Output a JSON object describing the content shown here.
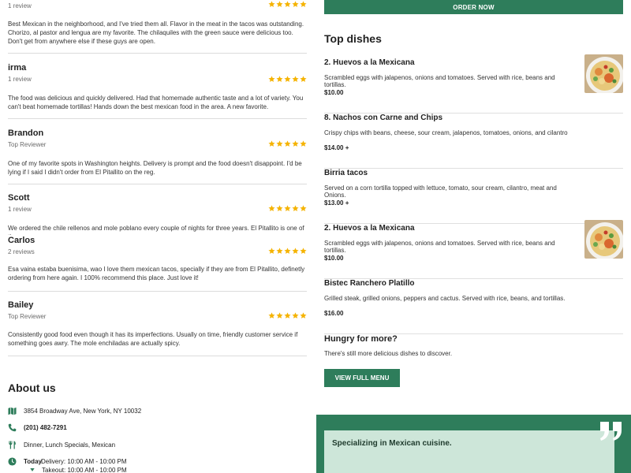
{
  "reviews": [
    {
      "name": "",
      "meta": "1 review",
      "text": "Best Mexican in the neighborhood, and I've tried them all. Flavor in the meat in the tacos was outstanding. Chorizo, al pastor and lengua are my favorite. The chilaquiles with the green sauce were delicious too. Don't get from anywhere else if these guys are open.",
      "rating": 5
    },
    {
      "name": "irma",
      "meta": "1 review",
      "text": "The food was delicious and quickly delivered. Had that homemade authentic taste and a lot of variety. You can't beat homemade tortillas! Hands down the best mexican food in the area. A new favorite.",
      "rating": 5
    },
    {
      "name": "Brandon",
      "meta": "Top Reviewer",
      "text": "One of my favorite spots in Washington heights. Delivery is prompt and the food doesn't disappoint. I'd be lying if I said I didn't order from El Pitallito on the reg.",
      "rating": 5
    },
    {
      "name": "Scott",
      "meta": "1 review",
      "text": "We ordered the chile rellenos and mole poblano every couple of nights for three years. El Pitallito is one of the",
      "rating": 5
    },
    {
      "name": "Carlos",
      "meta": "2 reviews",
      "text": "Esa vaina estaba buenisima, wao I love them mexican tacos, specially if they are from El Pitallito, definetly ordering from here again. I 100% recommend this place. Just love it!",
      "rating": 5
    },
    {
      "name": "Bailey",
      "meta": "Top Reviewer",
      "text": "Consistently good food even though it has its imperfections. Usually on time, friendly customer service if something goes awry. The mole enchiladas are actually spicy.",
      "rating": 5
    }
  ],
  "about": {
    "title": "About us",
    "address": "3854 Broadway Ave, New York, NY 10032",
    "phone": "(201) 482-7291",
    "services": "Dinner, Lunch Specials, Mexican",
    "hours_today_label": "Today",
    "hours_delivery": "Delivery: 10:00 AM - 10:00 PM",
    "hours_takeout": "Takeout: 10:00 AM - 10:00 PM"
  },
  "order_button": "ORDER NOW",
  "top_dishes": {
    "title": "Top dishes",
    "items": [
      {
        "name": "2. Huevos a la Mexicana",
        "desc": "Scrambled eggs with jalapenos, onions and tomatoes. Served with rice, beans and tortillas.",
        "price": "$10.00",
        "has_image": true
      },
      {
        "name": "8. Nachos con Carne and Chips",
        "desc": "Crispy chips with beans, cheese, sour cream, jalapenos, tomatoes, onions, and cilantro",
        "price": "$14.00 +",
        "has_image": false
      },
      {
        "name": "Birria tacos",
        "desc": "Served on a corn tortilla topped with lettuce, tomato, sour cream, cilantro, meat and Onions.",
        "price": "$13.00 +",
        "has_image": false
      },
      {
        "name": "2. Huevos a la Mexicana",
        "desc": "Scrambled eggs with jalapenos, onions and tomatoes. Served with rice, beans and tortillas.",
        "price": "$10.00",
        "has_image": true
      },
      {
        "name": "Bistec Ranchero Platillo",
        "desc": "Grilled steak, grilled onions, peppers and cactus. Served with rice, beans, and tortillas.",
        "price": "$16.00",
        "has_image": false
      }
    ]
  },
  "hungry": {
    "title": "Hungry for more?",
    "text": "There's still more delicious dishes to discover.",
    "button": "VIEW FULL MENU"
  },
  "specializing": {
    "text": "Specializing in Mexican cuisine."
  },
  "colors": {
    "brand_green": "#2e7d5b",
    "star": "#f5b301",
    "quote_card": "#cde6d9"
  },
  "icons": {
    "star": "star-icon",
    "address": "map-icon",
    "phone": "phone-icon",
    "services": "utensils-icon",
    "hours": "clock-icon",
    "quote": "quote-icon"
  }
}
